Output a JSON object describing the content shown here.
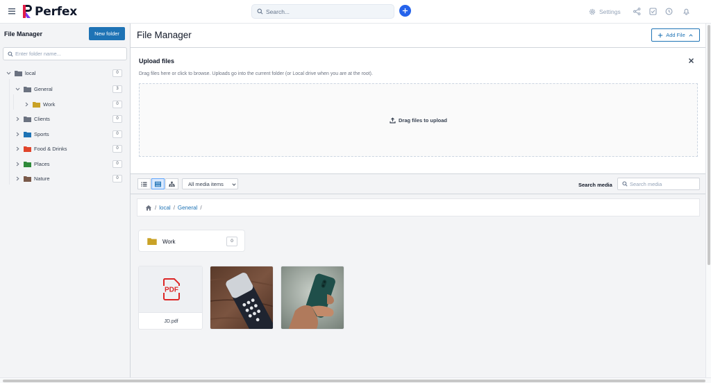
{
  "app": {
    "logo_text": "Perfex",
    "search_placeholder": "Search...",
    "settings_label": "Settings",
    "colors": {
      "primary": "#1e73b5",
      "accent": "#2563eb"
    }
  },
  "sidebar": {
    "title": "File Manager",
    "new_folder_label": "New folder",
    "folder_search_placeholder": "Enter folder name...",
    "folders": [
      {
        "label": "local",
        "count": "0",
        "color": "#6b7280",
        "expanded": true
      },
      {
        "label": "General",
        "count": "3",
        "color": "#6b7280",
        "expanded": true
      },
      {
        "label": "Work",
        "count": "0",
        "color": "#c9a227",
        "expanded": false
      },
      {
        "label": "Clients",
        "count": "0",
        "color": "#6b7280",
        "expanded": false
      },
      {
        "label": "Sports",
        "count": "0",
        "color": "#1e73b5",
        "expanded": false
      },
      {
        "label": "Food & Drinks",
        "count": "0",
        "color": "#e0452b",
        "expanded": false
      },
      {
        "label": "Places",
        "count": "0",
        "color": "#2f8a3a",
        "expanded": false
      },
      {
        "label": "Nature",
        "count": "0",
        "color": "#7a5a4a",
        "expanded": false
      }
    ]
  },
  "main": {
    "title": "File Manager",
    "add_file_label": "Add File",
    "upload": {
      "title": "Upload files",
      "hint": "Drag files here or click to browse. Uploads go into the current folder (or Local drive when you are at the root).",
      "dropzone_label": "Drag files to upload"
    },
    "toolbar": {
      "filter_selected": "All media items",
      "search_label": "Search media",
      "search_placeholder": "Search media"
    },
    "breadcrumb": [
      "local",
      "General"
    ],
    "folders": [
      {
        "name": "Work",
        "count": "0"
      }
    ],
    "files": [
      {
        "name": "JD.pdf",
        "icon": "pdf-icon"
      }
    ],
    "images": [
      {
        "icon": "image-remote-control"
      },
      {
        "icon": "image-phone-in-hand"
      }
    ]
  }
}
